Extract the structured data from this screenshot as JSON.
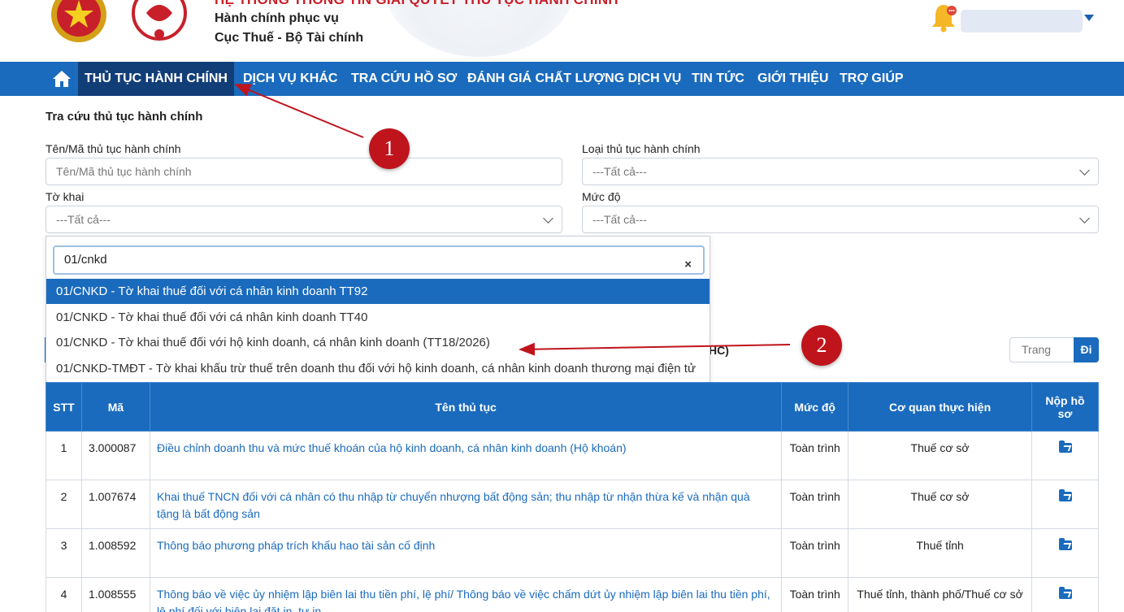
{
  "header": {
    "system_title": "HỆ THỐNG THÔNG TIN GIẢI QUYẾT THỦ TỤC HÀNH CHÍNH",
    "subtitle1": "Hành chính phục vụ",
    "subtitle2": "Cục Thuế - Bộ Tài chính"
  },
  "nav": {
    "items": [
      {
        "label": "THỦ TỤC HÀNH CHÍNH"
      },
      {
        "label": "DỊCH VỤ KHÁC"
      },
      {
        "label": "TRA CỨU HỒ SƠ"
      },
      {
        "label": "ĐÁNH GIÁ CHẤT LƯỢNG DỊCH VỤ"
      },
      {
        "label": "TIN TỨC"
      },
      {
        "label": "GIỚI THIỆU"
      },
      {
        "label": "TRỢ GIÚP"
      }
    ]
  },
  "search": {
    "section_title": "Tra cứu thủ tục hành chính",
    "name_label": "Tên/Mã thủ tục hành chính",
    "name_placeholder": "Tên/Mã thủ tục hành chính",
    "type_label": "Loại thủ tục hành chính",
    "type_value": "---Tất cả---",
    "form_label": "Tờ khai",
    "form_value": "---Tất cả---",
    "level_label": "Mức độ",
    "level_value": "---Tất cả---"
  },
  "dropdown": {
    "query": "01/cnkd",
    "clear_icon": "×",
    "options": [
      {
        "label": "01/CNKD - Tờ khai thuế đối với cá nhân kinh doanh TT92",
        "highlighted": true
      },
      {
        "label": "01/CNKD - Tờ khai thuế đối với cá nhân kinh doanh TT40",
        "highlighted": false
      },
      {
        "label": "01/CNKD - Tờ khai thuế đối với hộ kinh doanh, cá nhân kinh doanh (TT18/2026)",
        "highlighted": false
      },
      {
        "label": "01/CNKD-TMĐT - Tờ khai khấu trừ thuế trên doanh thu đối với hộ kinh doanh, cá nhân kinh doanh thương mại điện tử",
        "highlighted": false
      }
    ]
  },
  "annotations": {
    "badge1": "1",
    "badge2": "2"
  },
  "pager": {
    "partial_text": "HC)",
    "page_placeholder": "Trang",
    "go_label": "Đi"
  },
  "table": {
    "headers": [
      "STT",
      "Mã",
      "Tên thủ tục",
      "Mức độ",
      "Cơ quan thực hiện",
      "Nộp hồ sơ"
    ],
    "rows": [
      {
        "stt": "1",
        "code": "3.000087",
        "name": "Điều chỉnh doanh thu và mức thuế khoán của hộ kinh doanh, cá nhân kinh doanh (Hộ khoán)",
        "level": "Toàn trình",
        "agency": "Thuế cơ sở"
      },
      {
        "stt": "2",
        "code": "1.007674",
        "name": "Khai thuế TNCN đối với cá nhân có thu nhập từ chuyển nhượng bất động sản; thu nhập từ nhận thừa kế và nhận quà tặng là bất động sản",
        "level": "Toàn trình",
        "agency": "Thuế cơ sở"
      },
      {
        "stt": "3",
        "code": "1.008592",
        "name": "Thông báo phương pháp trích khấu hao tài sản cố định",
        "level": "Toàn trình",
        "agency": "Thuế tỉnh"
      },
      {
        "stt": "4",
        "code": "1.008555",
        "name": "Thông báo về việc ủy nhiệm lập biên lai thu tiền phí, lệ phí/ Thông báo về việc chấm dứt ủy nhiệm lập biên lai thu tiền phí, lệ phí đối với biên lai đặt in, tự in",
        "level": "Toàn trình",
        "agency": "Thuế tỉnh, thành phố/Thuế cơ sở"
      }
    ]
  },
  "colors": {
    "primary": "#1a6bbd",
    "nav_active": "#123e78",
    "badge": "#c0141c",
    "title_red": "#c8202a"
  },
  "icons": [
    "home-icon",
    "bell-icon",
    "chevron-down-icon",
    "close-icon",
    "folder-upload-icon"
  ]
}
